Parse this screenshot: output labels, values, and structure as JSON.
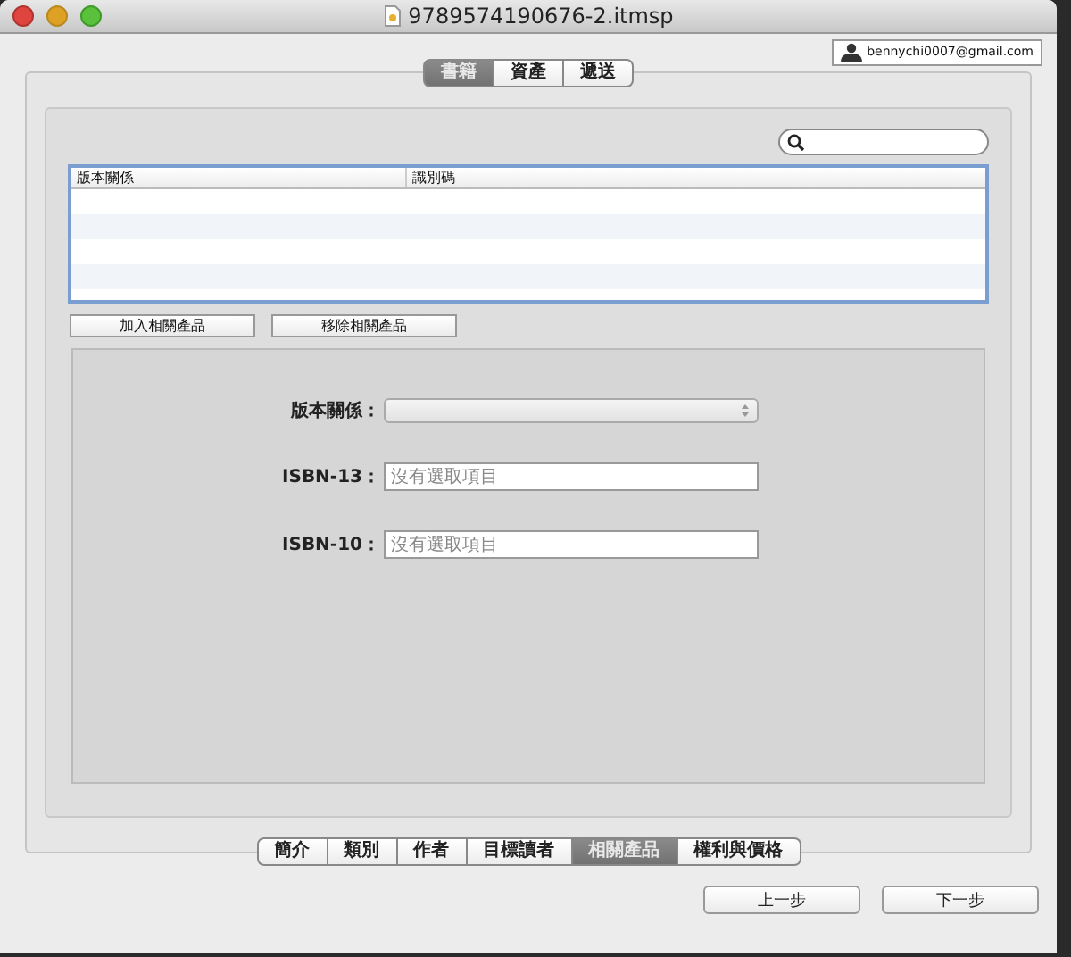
{
  "window": {
    "title": "9789574190676-2.itmsp"
  },
  "account": {
    "email": "bennychi0007@gmail.com"
  },
  "top_tabs": [
    {
      "label": "書籍",
      "selected": true
    },
    {
      "label": "資產",
      "selected": false
    },
    {
      "label": "遞送",
      "selected": false
    }
  ],
  "table": {
    "columns": [
      "版本關係",
      "識別碼"
    ]
  },
  "table_buttons": [
    "加入相關產品",
    "移除相關產品"
  ],
  "form": {
    "relation_label": "版本關係：",
    "isbn13_label": "ISBN-13：",
    "isbn13_placeholder": "沒有選取項目",
    "isbn10_label": "ISBN-10：",
    "isbn10_placeholder": "沒有選取項目"
  },
  "bottom_tabs": [
    {
      "label": "簡介",
      "selected": false
    },
    {
      "label": "類別",
      "selected": false
    },
    {
      "label": "作者",
      "selected": false
    },
    {
      "label": "目標讀者",
      "selected": false
    },
    {
      "label": "相關產品",
      "selected": true
    },
    {
      "label": "權利與價格",
      "selected": false
    }
  ],
  "nav_buttons": [
    "上一步",
    "下一步"
  ]
}
